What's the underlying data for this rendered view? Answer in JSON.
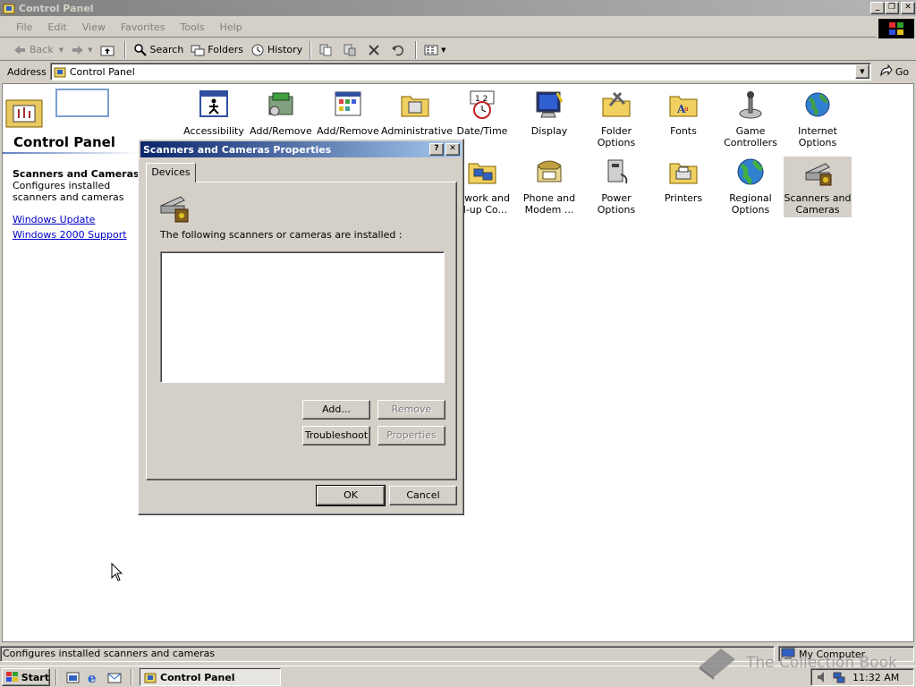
{
  "window": {
    "title": "Control Panel"
  },
  "menu": [
    "File",
    "Edit",
    "View",
    "Favorites",
    "Tools",
    "Help"
  ],
  "toolbar": {
    "back": "Back",
    "search": "Search",
    "folders": "Folders",
    "history": "History"
  },
  "address": {
    "label": "Address",
    "value": "Control Panel",
    "go": "Go"
  },
  "left_panel": {
    "title": "Control Panel",
    "selected_title": "Scanners and Cameras",
    "selected_desc": "Configures installed scanners and cameras",
    "links": [
      "Windows Update",
      "Windows 2000 Support"
    ]
  },
  "icons_row1": [
    {
      "label": "Accessibility Options",
      "icon": "accessibility-icon"
    },
    {
      "label": "Add/Remove Hardware",
      "icon": "hardware-icon"
    },
    {
      "label": "Add/Remove Programs",
      "icon": "programs-icon"
    },
    {
      "label": "Administrative Tools",
      "icon": "admin-tools-icon"
    },
    {
      "label": "Date/Time",
      "icon": "clock-icon"
    },
    {
      "label": "Display",
      "icon": "monitor-icon"
    },
    {
      "label": "Folder Options",
      "icon": "folder-options-icon"
    },
    {
      "label": "Fonts",
      "icon": "fonts-folder-icon"
    },
    {
      "label": "Game Controllers",
      "icon": "joystick-icon"
    },
    {
      "label": "Internet Options",
      "icon": "globe-icon"
    }
  ],
  "icons_row2": [
    {
      "label": "etwork and al-up Co...",
      "icon": "network-icon"
    },
    {
      "label": "Phone and Modem ...",
      "icon": "phone-icon"
    },
    {
      "label": "Power Options",
      "icon": "power-icon"
    },
    {
      "label": "Printers",
      "icon": "printer-folder-icon"
    },
    {
      "label": "Regional Options",
      "icon": "globe-icon"
    },
    {
      "label": "Scanners and Cameras",
      "icon": "scanner-icon"
    }
  ],
  "dialog": {
    "title": "Scanners and Cameras Properties",
    "help": "?",
    "close": "✕",
    "tab": "Devices",
    "installed_text": "The following scanners or cameras are installed :",
    "add": "Add...",
    "remove": "Remove",
    "troubleshoot": "Troubleshoot",
    "properties": "Properties",
    "ok": "OK",
    "cancel": "Cancel"
  },
  "status": {
    "text": "Configures installed scanners and cameras",
    "zone": "My Computer"
  },
  "taskbar": {
    "start": "Start",
    "task": "Control Panel",
    "time": "11:32 AM"
  },
  "watermark": "The Collection Book",
  "colors": {
    "dialog_title_start": "#0a246a",
    "dialog_title_end": "#a6caf0",
    "inactive_title": "#808080",
    "link": "#0000cc",
    "face": "#d4d0c8"
  }
}
